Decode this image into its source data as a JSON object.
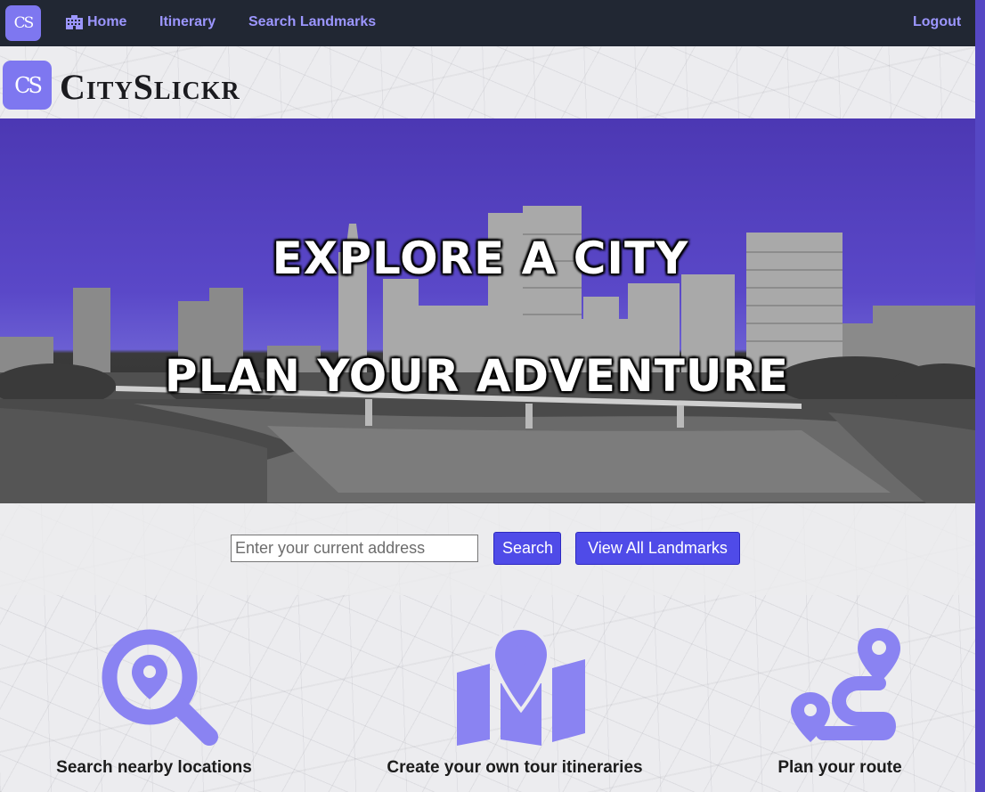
{
  "navbar": {
    "logo_text": "CS",
    "home_label": "Home",
    "itinerary_label": "Itinerary",
    "search_landmarks_label": "Search Landmarks",
    "logout_label": "Logout"
  },
  "brand": {
    "logo_text": "CS",
    "name": "CitySlickr"
  },
  "hero": {
    "line1": "EXPLORE A CITY",
    "line2": "PLAN YOUR ADVENTURE"
  },
  "search": {
    "placeholder": "Enter your current address",
    "value": "",
    "search_button": "Search",
    "view_all_button": "View All Landmarks"
  },
  "features": [
    {
      "icon": "search-location-icon",
      "label": "Search nearby locations"
    },
    {
      "icon": "map-location-icon",
      "label": "Create your own tour itineraries"
    },
    {
      "icon": "route-icon",
      "label": "Plan your route"
    }
  ],
  "colors": {
    "accent": "#7e77f0",
    "nav_bg": "#212733",
    "nav_link": "#9c96ff",
    "button": "#4f4be8",
    "hero_sky": "#5a48c8"
  }
}
